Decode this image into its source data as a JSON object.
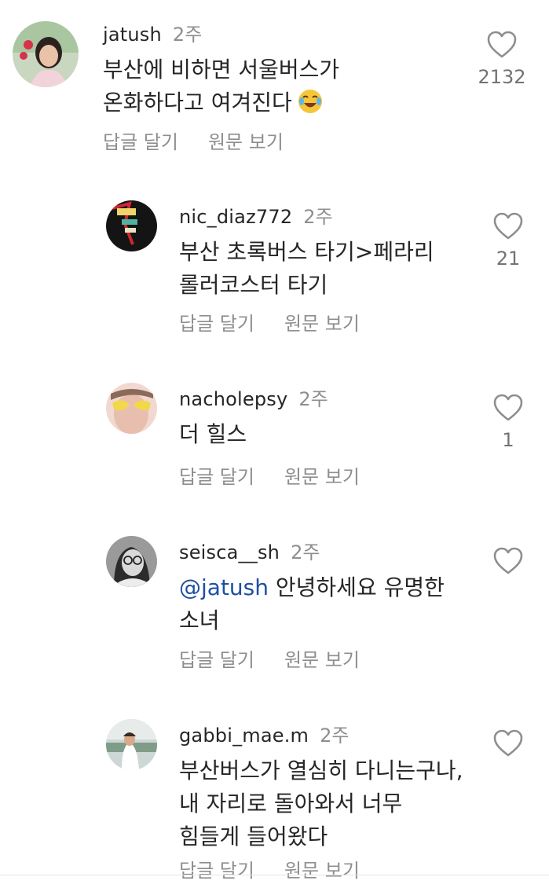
{
  "actions": {
    "reply": "답글 달기",
    "see_original": "원문 보기"
  },
  "comments": [
    {
      "username": "jatush",
      "time": "2주",
      "lines": [
        "부산에 비하면 서울버스가",
        "온화하다고 여겨진다"
      ],
      "emoji": "face-with-tears-of-joy-icon",
      "likes": "2132"
    },
    {
      "username": "nic_diaz772",
      "time": "2주",
      "lines": [
        "부산 초록버스 타기>페라리",
        "롤러코스터 타기"
      ],
      "likes": "21"
    },
    {
      "username": "nacholepsy",
      "time": "2주",
      "lines": [
        "더 힐스"
      ],
      "likes": "1"
    },
    {
      "username": "seisca__sh",
      "time": "2주",
      "mention": "@jatush",
      "lines": [
        "안녕하세요 유명한",
        "소녀"
      ],
      "likes": ""
    },
    {
      "username": "gabbi_mae.m",
      "time": "2주",
      "lines": [
        "부산버스가 열심히 다니는구나,",
        "내 자리로 돌아와서 너무",
        "힘들게 들어왔다"
      ],
      "likes": ""
    }
  ],
  "colors": {
    "username": "#262626",
    "meta": "#8e8e8e",
    "mention": "#1f4fa0",
    "heart": "#8e8e8e"
  }
}
